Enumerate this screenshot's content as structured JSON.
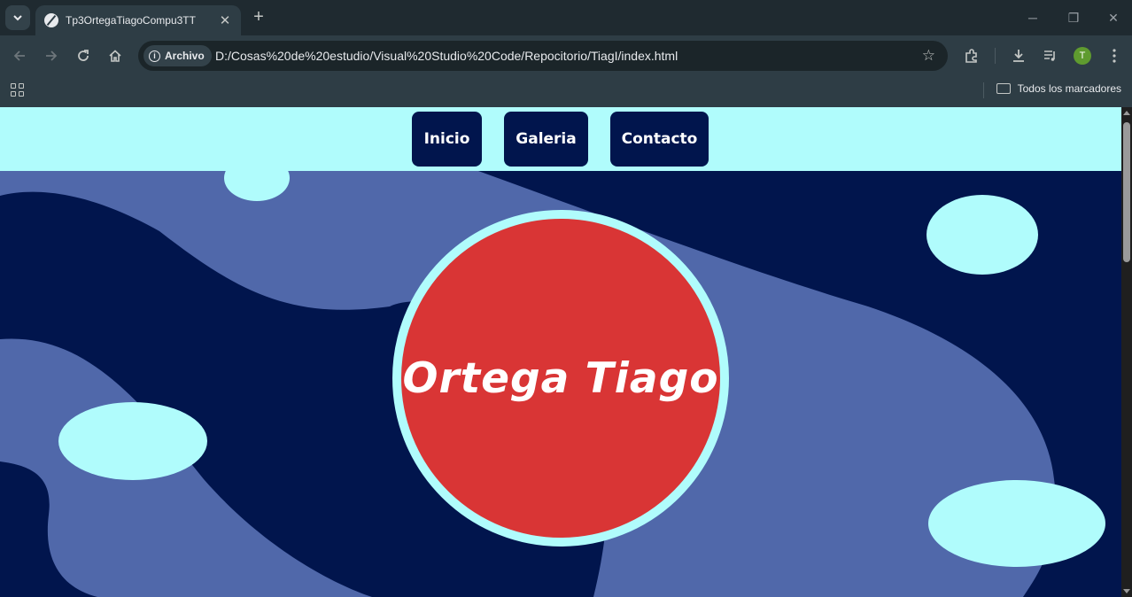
{
  "browser": {
    "tab": {
      "title": "Tp3OrtegaTiagoCompu3TT",
      "close_glyph": "✕"
    },
    "new_tab_glyph": "+",
    "window_controls": {
      "minimize": "─",
      "restore": "❐",
      "close": "✕"
    },
    "omnibox": {
      "security_chip": "Archivo",
      "url": "D:/Cosas%20de%20estudio/Visual%20Studio%20Code/Repocitorio/TiagI/index.html"
    },
    "profile_initial": "T",
    "bookmarks": {
      "folder_label": "Todos los marcadores"
    }
  },
  "page": {
    "nav": {
      "items": [
        "Inicio",
        "Galeria",
        "Contacto"
      ]
    },
    "hero_title": "Ortega Tiago"
  },
  "colors": {
    "nav_background": "#b0fcfc",
    "nav_button": "#01154d",
    "page_background": "#01154d",
    "wave": "#5068aa",
    "bubble": "#b0fcfc",
    "hero_circle": "#d93535",
    "hero_border": "#b0fcfc"
  },
  "icons": [
    "tab-search-icon",
    "back-icon",
    "forward-icon",
    "reload-icon",
    "home-icon",
    "info-icon",
    "star-icon",
    "extensions-icon",
    "download-icon",
    "media-icon",
    "menu-icon",
    "apps-icon",
    "folder-icon"
  ]
}
